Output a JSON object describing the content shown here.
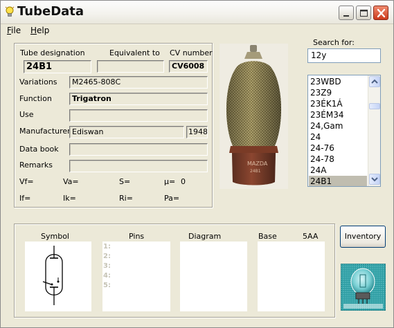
{
  "window": {
    "title": "TubeData"
  },
  "menu": {
    "file_prefix": "F",
    "file_rest": "ile",
    "help_prefix": "H",
    "help_rest": "elp"
  },
  "labels": {
    "tube_designation": "Tube designation",
    "equivalent_to": "Equivalent to",
    "cv_number": "CV number",
    "variations": "Variations",
    "function": "Function",
    "use": "Use",
    "manufacturer": "Manufacturer",
    "data_book": "Data book",
    "remarks": "Remarks",
    "vf": "Vf=",
    "va": "Va=",
    "s": "S=",
    "mu": "µ=",
    "if": "If=",
    "ik": "Ik=",
    "ri": "Ri=",
    "pa": "Pa="
  },
  "values": {
    "tube_designation": "24B1",
    "equivalent_to": "",
    "cv_number": "CV6008",
    "variations": "M2465-808C",
    "function": "Trigatron",
    "use": "",
    "manufacturer": "Ediswan",
    "year": "1948",
    "data_book": "",
    "remarks": "",
    "mu_value": "0"
  },
  "search": {
    "label": "Search for:",
    "value": "12y"
  },
  "tube_list": {
    "items": [
      "23WBD",
      "23Z9",
      "23ÉK1Á",
      "23ÉM34",
      "24,Gam",
      "24",
      "24-76",
      "24-78",
      "24A",
      "24B1"
    ],
    "selected": "24B1"
  },
  "bottom": {
    "symbol_label": "Symbol",
    "pins_label": "Pins",
    "diagram_label": "Diagram",
    "base_label": "Base",
    "base_value": "5AA",
    "pin_numbers": [
      "1:",
      "2:",
      "3:",
      "4:",
      "5:"
    ]
  },
  "buttons": {
    "inventory": "Inventory"
  },
  "icons": {
    "app": "lightbulb-icon",
    "minimize": "minimize-icon",
    "maximize": "maximize-icon",
    "close": "close-icon"
  },
  "colors": {
    "close_button": "#cc3a1c",
    "selection": "#c0bdb0",
    "window_bg": "#ece9d8"
  }
}
